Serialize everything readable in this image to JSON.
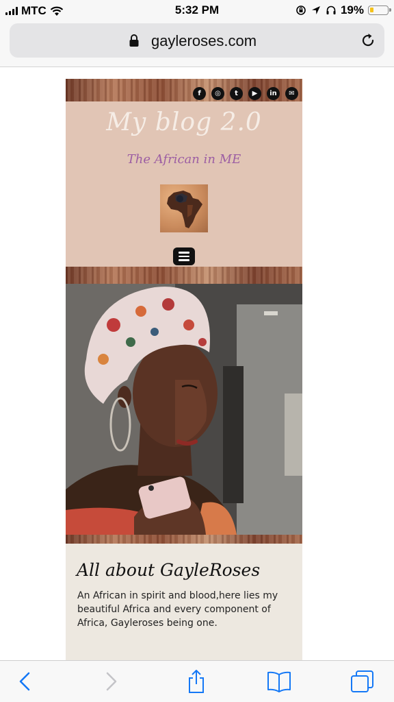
{
  "status_bar": {
    "carrier": "MTC",
    "time": "5:32 PM",
    "battery_percent": "19%",
    "battery_level": 0.19,
    "battery_color": "#f5c21a",
    "icons": [
      "signal-icon",
      "wifi-icon",
      "screen-lock-icon",
      "location-icon",
      "headphones-icon",
      "battery-icon"
    ]
  },
  "browser": {
    "url": "gayleroses.com",
    "toolbar": [
      "back-icon",
      "forward-icon",
      "share-icon",
      "bookmarks-icon",
      "tabs-icon"
    ]
  },
  "site": {
    "social_icons": [
      {
        "name": "facebook-icon",
        "glyph": "f"
      },
      {
        "name": "instagram-icon",
        "glyph": "◎"
      },
      {
        "name": "twitter-icon",
        "glyph": "t"
      },
      {
        "name": "youtube-icon",
        "glyph": "▶"
      },
      {
        "name": "linkedin-icon",
        "glyph": "in"
      },
      {
        "name": "email-icon",
        "glyph": "✉"
      }
    ],
    "title": "My blog 2.0",
    "tagline": "The African in ME",
    "colors": {
      "header_bg": "#e1c5b5",
      "tagline": "#9c5ea3",
      "about_bg": "#ede8e0"
    }
  },
  "about": {
    "title": "All about GayleRoses",
    "text": "An African in spirit and blood,here lies my beautiful Africa and every component of Africa, Gayleroses being one."
  }
}
